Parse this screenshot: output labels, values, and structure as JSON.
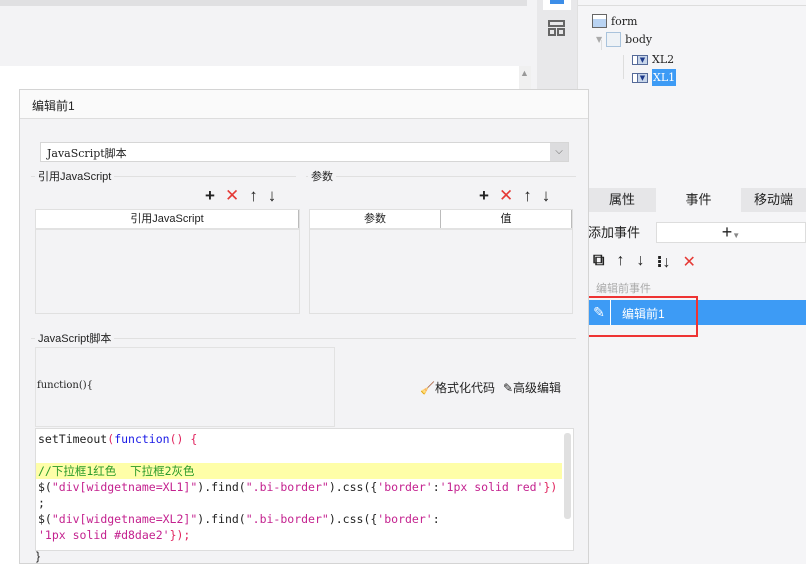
{
  "tree": {
    "items": [
      {
        "label": "form"
      },
      {
        "label": "body"
      },
      {
        "label": "XL2"
      },
      {
        "label": "XL1",
        "selected": true
      }
    ]
  },
  "dialog": {
    "title": "编辑前1",
    "type_select": {
      "value": "JavaScript脚本"
    },
    "ref_js": {
      "legend": "引用JavaScript",
      "column": "引用JavaScript"
    },
    "params": {
      "legend": "参数",
      "columns": [
        "参数",
        "值"
      ]
    },
    "script": {
      "legend": "JavaScript脚本",
      "header": "function(){",
      "format_label": "格式化代码",
      "advanced_label": "高级编辑",
      "footer": "}"
    },
    "toolbar": {
      "add": "+",
      "delete": "✕",
      "up": "↑",
      "down": "↓"
    }
  },
  "code": {
    "line1": [
      "setTimeout",
      "(",
      "function",
      "()",
      " {"
    ],
    "comment": "//下拉框1红色  下拉框2灰色",
    "line3": [
      "$(",
      "\"div[widgetname=XL1]\"",
      ").find(",
      "\".bi-border\"",
      ").css({",
      "'border'",
      ":",
      "'1px solid red'",
      "})"
    ],
    "line4": ";",
    "line5": [
      "$(",
      "\"div[widgetname=XL2]\"",
      ").find(",
      "\".bi-border\"",
      ").css({",
      "'border'",
      ":"
    ],
    "line6": [
      "'1px solid #d8dae2'",
      "});"
    ]
  },
  "right_panel": {
    "tabs": [
      "属性",
      "事件",
      "移动端"
    ],
    "add_event_label": "添加事件",
    "add_symbol": "+",
    "section_label": "编辑前事件",
    "events": [
      {
        "label": "编辑前1",
        "selected": true
      }
    ]
  },
  "colors": {
    "accent": "#3d9bf5",
    "highlight": "#ee3333"
  }
}
